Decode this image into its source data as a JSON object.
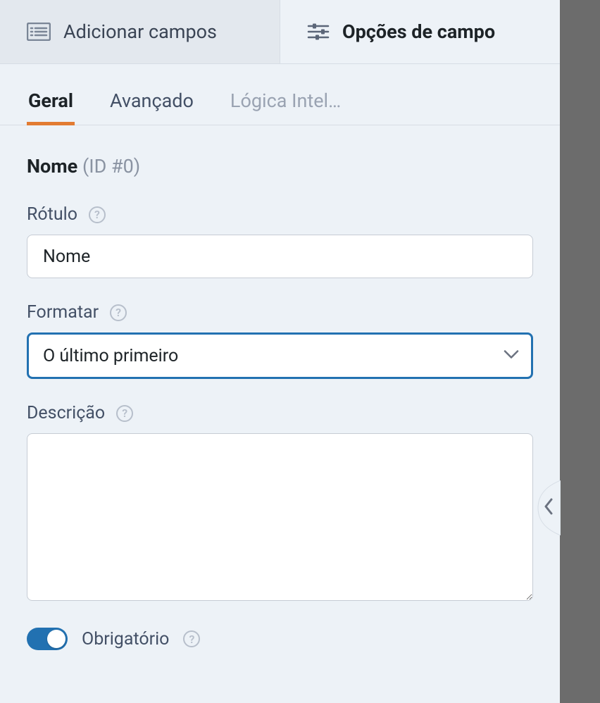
{
  "topTabs": {
    "addFields": {
      "label": "Adicionar campos"
    },
    "fieldOptions": {
      "label": "Opções de campo"
    }
  },
  "subTabs": {
    "general": "Geral",
    "advanced": "Avançado",
    "smartLogic": "Lógica Intel…"
  },
  "section": {
    "name": "Nome",
    "idText": "(ID #0)"
  },
  "labels": {
    "rotulo": "Rótulo",
    "formatar": "Formatar",
    "descricao": "Descrição",
    "obrigatorio": "Obrigatório"
  },
  "values": {
    "rotulo": "Nome",
    "formatarSelected": "O último primeiro",
    "descricao": ""
  },
  "toggle": {
    "obrigatorio_on": true
  }
}
